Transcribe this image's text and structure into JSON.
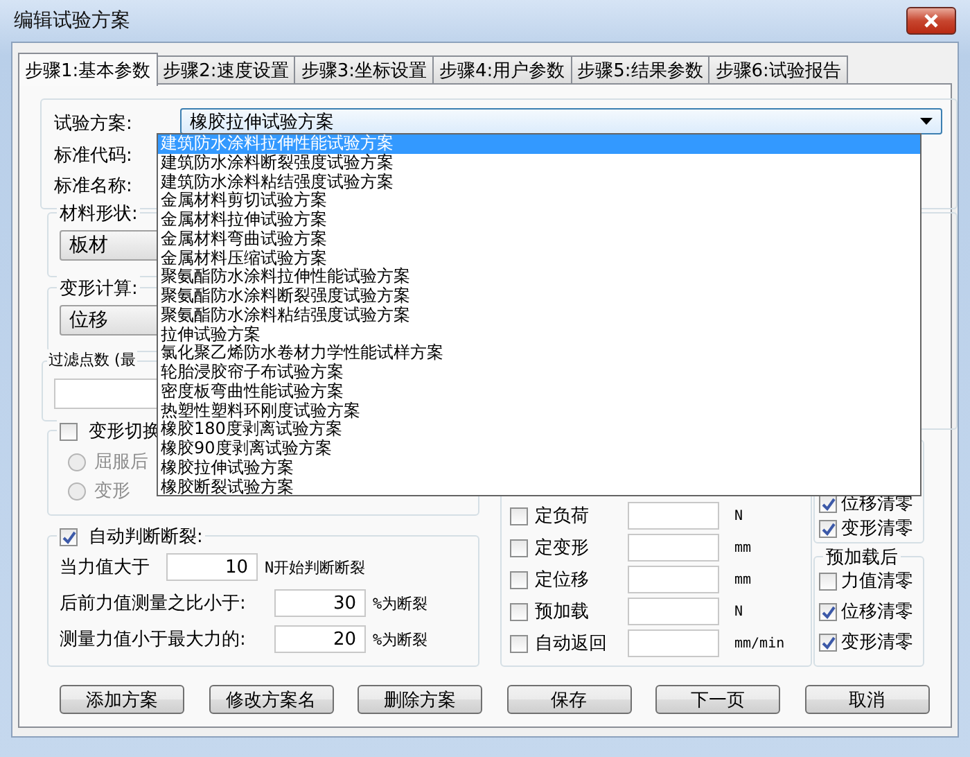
{
  "window": {
    "title": "编辑试验方案"
  },
  "tabs": [
    {
      "label": "步骤1:基本参数",
      "selected": true
    },
    {
      "label": "步骤2:速度设置",
      "selected": false
    },
    {
      "label": "步骤3:坐标设置",
      "selected": false
    },
    {
      "label": "步骤4:用户参数",
      "selected": false
    },
    {
      "label": "步骤5:结果参数",
      "selected": false
    },
    {
      "label": "步骤6:试验报告",
      "selected": false
    }
  ],
  "scheme": {
    "label": "试验方案:",
    "value": "橡胶拉伸试验方案",
    "fields": [
      "标准代码:",
      "标准名称:"
    ]
  },
  "dropdown": {
    "items": [
      {
        "label": "建筑防水涂料拉伸性能试验方案",
        "selected": true
      },
      {
        "label": "建筑防水涂料断裂强度试验方案",
        "selected": false
      },
      {
        "label": "建筑防水涂料粘结强度试验方案",
        "selected": false
      },
      {
        "label": "金属材料剪切试验方案",
        "selected": false
      },
      {
        "label": "金属材料拉伸试验方案",
        "selected": false
      },
      {
        "label": "金属材料弯曲试验方案",
        "selected": false
      },
      {
        "label": "金属材料压缩试验方案",
        "selected": false
      },
      {
        "label": "聚氨酯防水涂料拉伸性能试验方案",
        "selected": false
      },
      {
        "label": "聚氨酯防水涂料断裂强度试验方案",
        "selected": false
      },
      {
        "label": "聚氨酯防水涂料粘结强度试验方案",
        "selected": false
      },
      {
        "label": "拉伸试验方案",
        "selected": false
      },
      {
        "label": "氯化聚乙烯防水卷材力学性能试样方案",
        "selected": false
      },
      {
        "label": "轮胎浸胶帘子布试验方案",
        "selected": false
      },
      {
        "label": "密度板弯曲性能试验方案",
        "selected": false
      },
      {
        "label": "热塑性塑料环刚度试验方案",
        "selected": false
      },
      {
        "label": "橡胶180度剥离试验方案",
        "selected": false
      },
      {
        "label": "橡胶90度剥离试验方案",
        "selected": false
      },
      {
        "label": "橡胶拉伸试验方案",
        "selected": false
      },
      {
        "label": "橡胶断裂试验方案",
        "selected": false
      }
    ]
  },
  "left_groups": [
    {
      "kind": "select",
      "title": "材料形状:",
      "value": "板材"
    },
    {
      "kind": "select",
      "title": "变形计算:",
      "value": "位移"
    },
    {
      "kind": "input",
      "title": "过滤点数 (最"
    },
    {
      "kind": "checkgroup",
      "title": "变形切换",
      "checked": false,
      "options": [
        {
          "label": "屈服后",
          "selected": false,
          "disabled": true
        },
        {
          "label": "变形",
          "selected": false,
          "disabled": true
        }
      ]
    }
  ],
  "auto_break": {
    "title": "自动判断断裂:",
    "checked": true,
    "rows": [
      {
        "label": "当力值大于",
        "value": "10",
        "unit": "N开始判断断裂"
      },
      {
        "label": "后前力值测量之比小于:",
        "value": "30",
        "unit": "%为断裂"
      },
      {
        "label": "测量力值小于最大力的:",
        "value": "20",
        "unit": "%为断裂"
      }
    ]
  },
  "controls": [
    {
      "label": "定负荷",
      "checked": false,
      "unit": "N"
    },
    {
      "label": "定变形",
      "checked": false,
      "unit": "mm"
    },
    {
      "label": "定位移",
      "checked": false,
      "unit": "mm"
    },
    {
      "label": "预加载",
      "checked": false,
      "unit": "N"
    },
    {
      "label": "自动返回",
      "checked": false,
      "unit": "mm/min"
    }
  ],
  "zero_groups": [
    {
      "items": [
        {
          "label": "位移清零",
          "checked": true
        },
        {
          "label": "变形清零",
          "checked": true
        }
      ]
    },
    {
      "title": "预加载后",
      "items": [
        {
          "label": "力值清零",
          "checked": false
        },
        {
          "label": "位移清零",
          "checked": true
        },
        {
          "label": "变形清零",
          "checked": true
        }
      ]
    }
  ],
  "buttons": [
    "添加方案",
    "修改方案名",
    "删除方案",
    "保存",
    "下一页",
    "取消"
  ]
}
